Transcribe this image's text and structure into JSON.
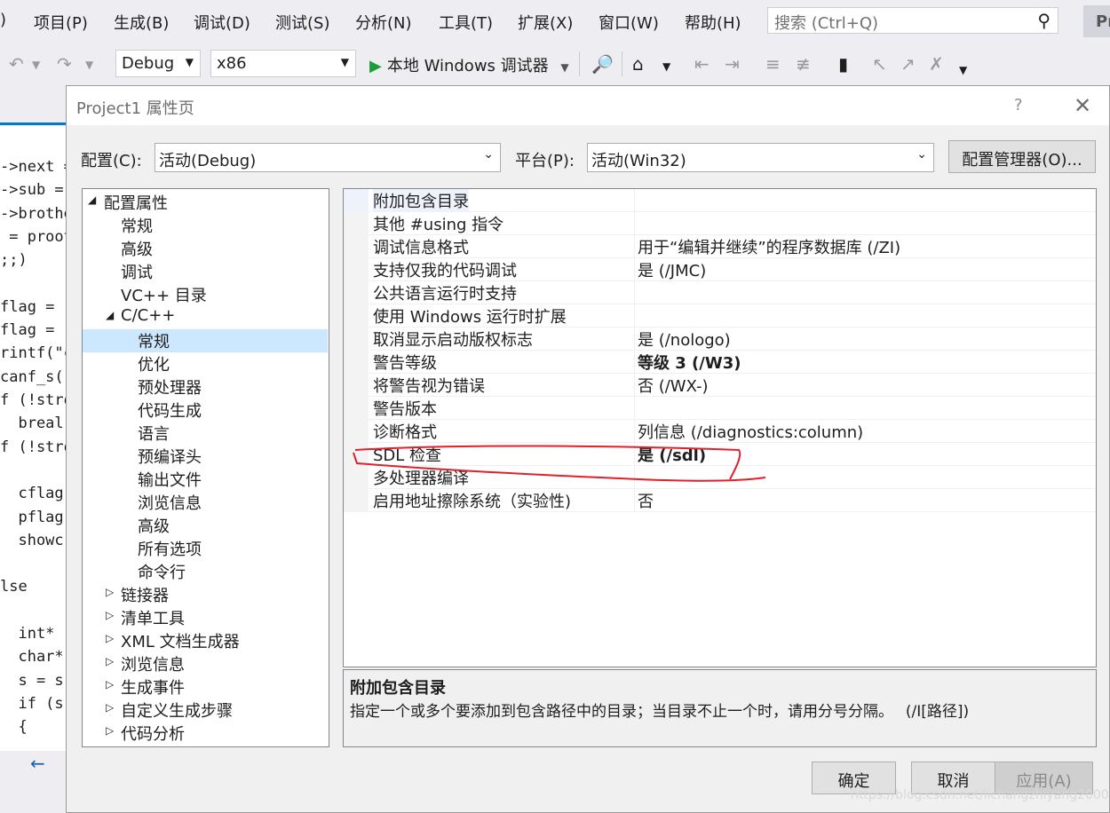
{
  "menubar": {
    "partial_left": ")",
    "items": [
      "项目(P)",
      "生成(B)",
      "调试(D)",
      "测试(S)",
      "分析(N)",
      "工具(T)",
      "扩展(X)",
      "窗口(W)",
      "帮助(H)"
    ],
    "search_placeholder": "搜索 (Ctrl+Q)",
    "profile_badge": "Pr"
  },
  "toolbar": {
    "config": "Debug",
    "platform": "x86",
    "run_label": "本地 Windows 调试器"
  },
  "editor": {
    "lines": [
      "->next =",
      "->sub =",
      "->brothe",
      " = proot",
      ";;)",
      "",
      "flag = (",
      "flag = (",
      "rintf(\"c",
      "canf_s(\"",
      "f (!stro",
      "  breal",
      "f (!stro",
      "",
      "  cflag",
      "  pflag",
      "  showc",
      "",
      "lse",
      "",
      "  int*",
      "  char*",
      "  s = s",
      "  if (s",
      "  {"
    ],
    "nav_arrow": "←"
  },
  "dialog": {
    "title": "Project1 属性页",
    "help": "?",
    "close": "✕",
    "config_label": "配置(C):",
    "config_value": "活动(Debug)",
    "platform_label": "平台(P):",
    "platform_value": "活动(Win32)",
    "config_manager": "配置管理器(O)...",
    "tree": [
      {
        "label": "配置属性",
        "level": 0,
        "twisty": "expanded"
      },
      {
        "label": "常规",
        "level": 1
      },
      {
        "label": "高级",
        "level": 1
      },
      {
        "label": "调试",
        "level": 1
      },
      {
        "label": "VC++ 目录",
        "level": 1
      },
      {
        "label": "C/C++",
        "level": 1,
        "twisty": "expanded"
      },
      {
        "label": "常规",
        "level": 2,
        "selected": true
      },
      {
        "label": "优化",
        "level": 2
      },
      {
        "label": "预处理器",
        "level": 2
      },
      {
        "label": "代码生成",
        "level": 2
      },
      {
        "label": "语言",
        "level": 2
      },
      {
        "label": "预编译头",
        "level": 2
      },
      {
        "label": "输出文件",
        "level": 2
      },
      {
        "label": "浏览信息",
        "level": 2
      },
      {
        "label": "高级",
        "level": 2
      },
      {
        "label": "所有选项",
        "level": 2
      },
      {
        "label": "命令行",
        "level": 2
      },
      {
        "label": "链接器",
        "level": 1,
        "twisty": "collapsed"
      },
      {
        "label": "清单工具",
        "level": 1,
        "twisty": "collapsed"
      },
      {
        "label": "XML 文档生成器",
        "level": 1,
        "twisty": "collapsed"
      },
      {
        "label": "浏览信息",
        "level": 1,
        "twisty": "collapsed"
      },
      {
        "label": "生成事件",
        "level": 1,
        "twisty": "collapsed"
      },
      {
        "label": "自定义生成步骤",
        "level": 1,
        "twisty": "collapsed"
      },
      {
        "label": "代码分析",
        "level": 1,
        "twisty": "collapsed"
      }
    ],
    "properties": [
      {
        "name": "附加包含目录",
        "value": ""
      },
      {
        "name": "其他 #using 指令",
        "value": ""
      },
      {
        "name": "调试信息格式",
        "value": "用于“编辑并继续”的程序数据库 (/ZI)"
      },
      {
        "name": "支持仅我的代码调试",
        "value": "是 (/JMC)"
      },
      {
        "name": "公共语言运行时支持",
        "value": ""
      },
      {
        "name": "使用 Windows 运行时扩展",
        "value": ""
      },
      {
        "name": "取消显示启动版权标志",
        "value": "是 (/nologo)"
      },
      {
        "name": "警告等级",
        "value": "等级 3 (/W3)",
        "bold": true
      },
      {
        "name": "将警告视为错误",
        "value": "否 (/WX-)"
      },
      {
        "name": "警告版本",
        "value": ""
      },
      {
        "name": "诊断格式",
        "value": "列信息 (/diagnostics:column)"
      },
      {
        "name": "SDL 检查",
        "value": "是 (/sdl)",
        "bold": true
      },
      {
        "name": "多处理器编译",
        "value": ""
      },
      {
        "name": "启用地址擦除系统（实验性)",
        "value": "否"
      }
    ],
    "description": {
      "title": "附加包含目录",
      "text": "指定一个或多个要添加到包含路径中的目录；当目录不止一个时，请用分号分隔。　 (/I[路径])"
    },
    "buttons": {
      "ok": "确定",
      "cancel": "取消",
      "apply": "应用(A)"
    }
  },
  "watermark": "https://blog.csdn.net/lichangzhiyang2000",
  "colors": {
    "selection": "#cce8ff",
    "annotation": "#e0202a",
    "run": "#1e9d3a"
  }
}
